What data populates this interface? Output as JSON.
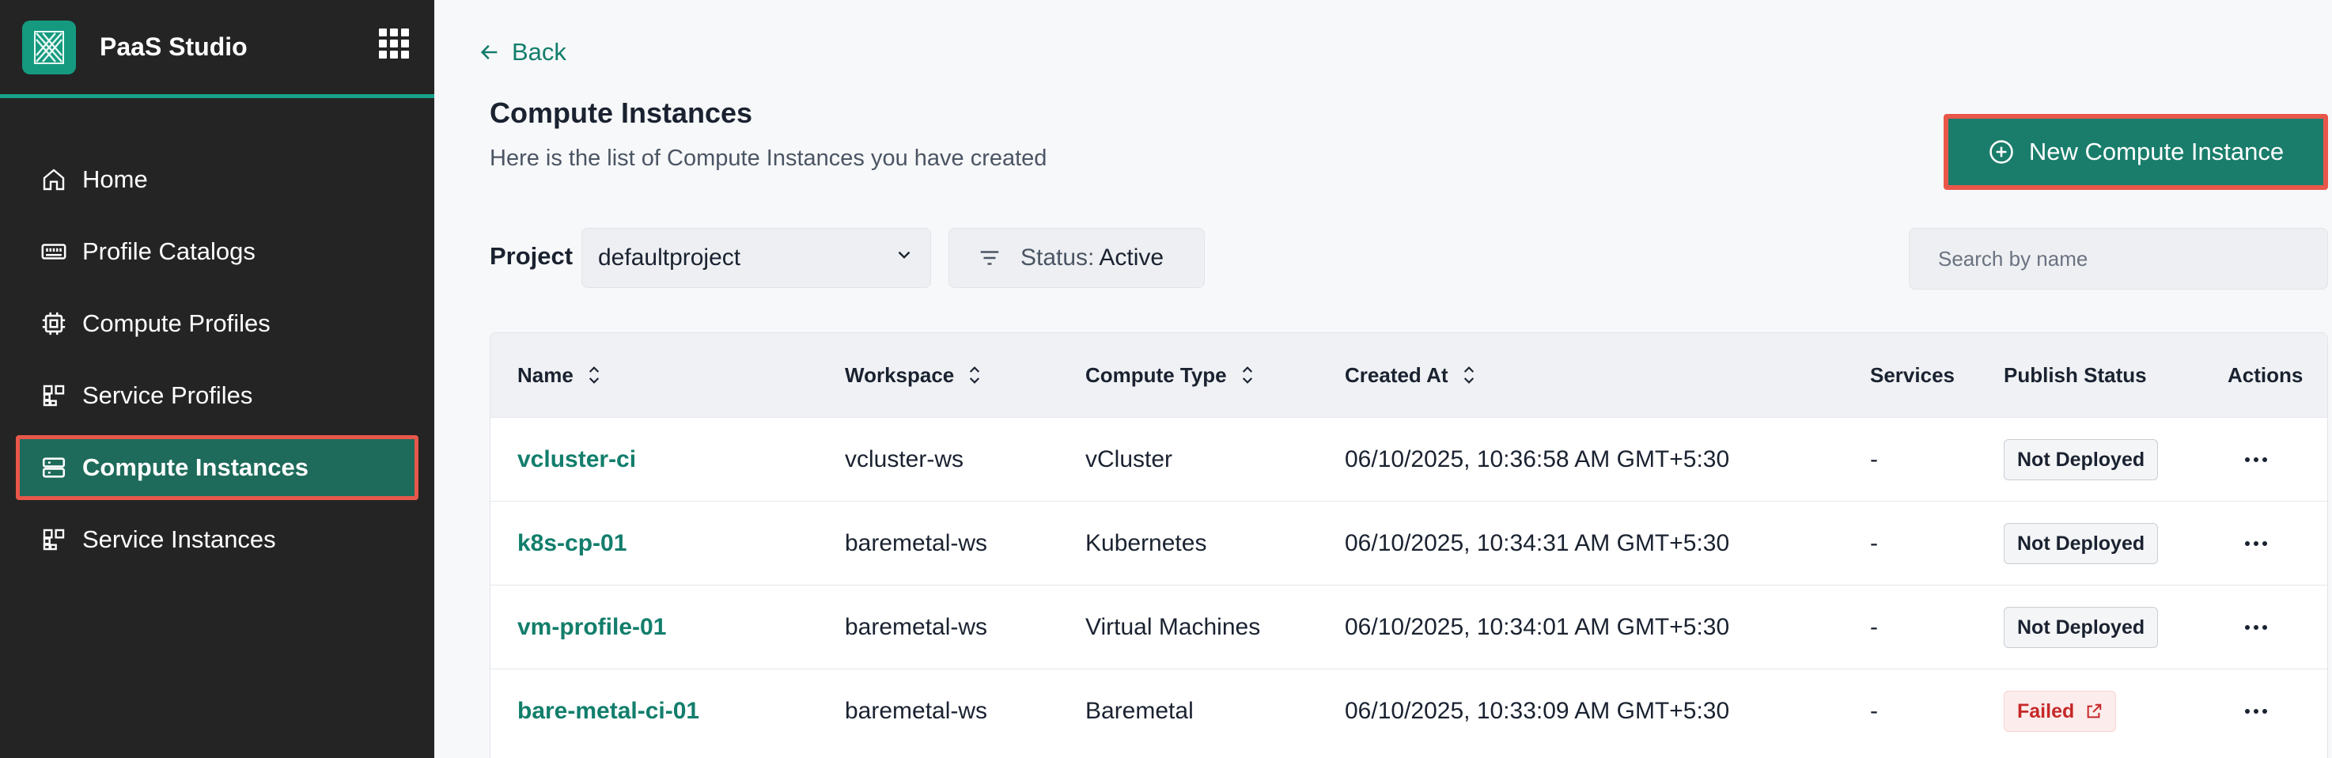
{
  "app": {
    "title": "PaaS Studio"
  },
  "sidebar": {
    "items": [
      {
        "label": "Home",
        "icon": "home-icon"
      },
      {
        "label": "Profile Catalogs",
        "icon": "catalog-icon"
      },
      {
        "label": "Compute Profiles",
        "icon": "chip-icon"
      },
      {
        "label": "Service Profiles",
        "icon": "blocks-icon"
      },
      {
        "label": "Compute Instances",
        "icon": "server-icon",
        "active": true
      },
      {
        "label": "Service Instances",
        "icon": "blocks-icon"
      }
    ]
  },
  "header": {
    "back_label": "Back",
    "title": "Compute Instances",
    "subtitle": "Here is the list of Compute Instances you have created",
    "new_button_label": "New Compute Instance"
  },
  "filters": {
    "project_label": "Project",
    "project_value": "defaultproject",
    "status_prefix": "Status:",
    "status_value": "Active",
    "search_placeholder": "Search by name"
  },
  "table": {
    "columns": [
      "Name",
      "Workspace",
      "Compute Type",
      "Created At",
      "Services",
      "Publish Status",
      "Actions"
    ],
    "rows": [
      {
        "name": "vcluster-ci",
        "workspace": "vcluster-ws",
        "compute_type": "vCluster",
        "created_at": "06/10/2025, 10:36:58 AM GMT+5:30",
        "services": "-",
        "publish_status": "Not Deployed"
      },
      {
        "name": "k8s-cp-01",
        "workspace": "baremetal-ws",
        "compute_type": "Kubernetes",
        "created_at": "06/10/2025, 10:34:31 AM GMT+5:30",
        "services": "-",
        "publish_status": "Not Deployed"
      },
      {
        "name": "vm-profile-01",
        "workspace": "baremetal-ws",
        "compute_type": "Virtual Machines",
        "created_at": "06/10/2025, 10:34:01 AM GMT+5:30",
        "services": "-",
        "publish_status": "Not Deployed"
      },
      {
        "name": "bare-metal-ci-01",
        "workspace": "baremetal-ws",
        "compute_type": "Baremetal",
        "created_at": "06/10/2025, 10:33:09 AM GMT+5:30",
        "services": "-",
        "publish_status": "Failed"
      }
    ]
  },
  "colors": {
    "accent": "#1a7d6b",
    "sidebar_bg": "#242424",
    "highlight": "#e8574a",
    "failed": "#c62828"
  }
}
